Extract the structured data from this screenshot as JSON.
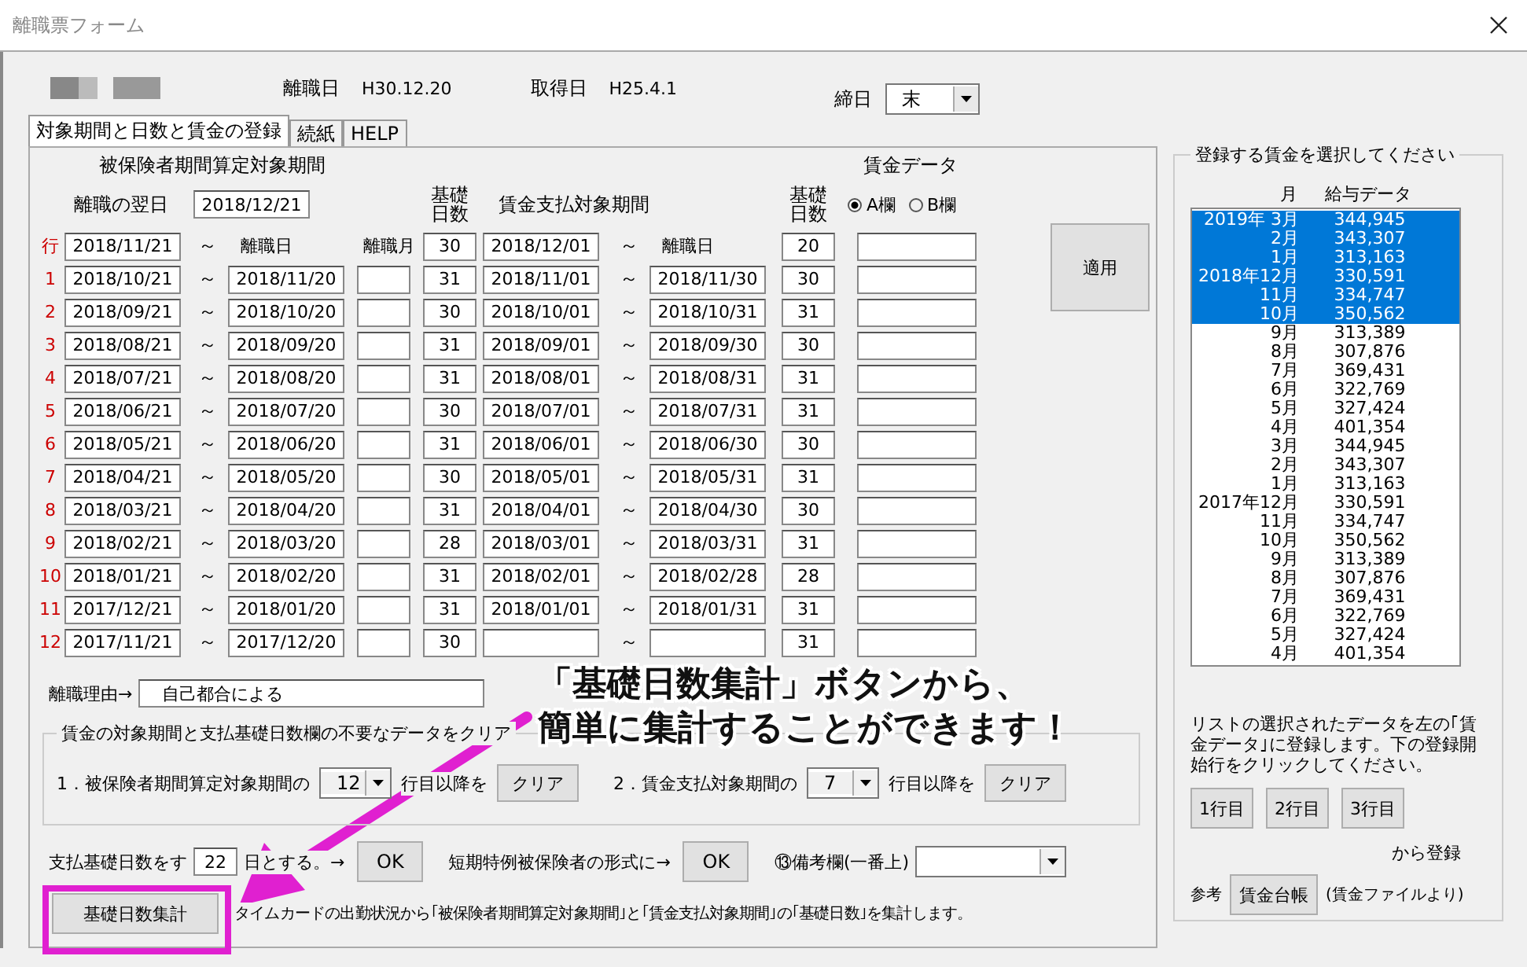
{
  "window": {
    "title": "離職票フォーム"
  },
  "header": {
    "fields": [
      {
        "label": "離職日",
        "value": "H30.12.20"
      },
      {
        "label": "取得日",
        "value": "H25.4.1"
      }
    ],
    "closing_day": {
      "label": "締日",
      "value": "末"
    }
  },
  "tabs": [
    {
      "label": "対象期間と日数と賃金の登録",
      "selected": true
    },
    {
      "label": "続紙",
      "selected": false
    },
    {
      "label": "HELP",
      "selected": false
    }
  ],
  "period": {
    "insured_heading": "被保険者期間算定対象期間",
    "next_day_label": "離職の翌日",
    "next_day": "2018/12/21",
    "days_heading": "基礎日数",
    "wage_heading": "賃金支払対象期間",
    "wage_days_heading": "基礎日数",
    "wage_data_heading": "賃金データ",
    "wage_columns": [
      {
        "label": "A欄",
        "selected": true
      },
      {
        "label": "B欄",
        "selected": false
      }
    ],
    "tilde": "～",
    "apply_button": "適用"
  },
  "rows": [
    {
      "label": "行",
      "start": "2018/11/21",
      "end_label": "離職日",
      "month_label": "離職月",
      "days": "30",
      "wage_start": "2018/12/01",
      "wage_end_label": "離職日",
      "wage_days": "20"
    },
    {
      "label": "1",
      "start": "2018/10/21",
      "end": "2018/11/20",
      "days": "31",
      "wage_start": "2018/11/01",
      "wage_end": "2018/11/30",
      "wage_days": "30"
    },
    {
      "label": "2",
      "start": "2018/09/21",
      "end": "2018/10/20",
      "days": "30",
      "wage_start": "2018/10/01",
      "wage_end": "2018/10/31",
      "wage_days": "31"
    },
    {
      "label": "3",
      "start": "2018/08/21",
      "end": "2018/09/20",
      "days": "31",
      "wage_start": "2018/09/01",
      "wage_end": "2018/09/30",
      "wage_days": "30"
    },
    {
      "label": "4",
      "start": "2018/07/21",
      "end": "2018/08/20",
      "days": "31",
      "wage_start": "2018/08/01",
      "wage_end": "2018/08/31",
      "wage_days": "31"
    },
    {
      "label": "5",
      "start": "2018/06/21",
      "end": "2018/07/20",
      "days": "30",
      "wage_start": "2018/07/01",
      "wage_end": "2018/07/31",
      "wage_days": "31"
    },
    {
      "label": "6",
      "start": "2018/05/21",
      "end": "2018/06/20",
      "days": "31",
      "wage_start": "2018/06/01",
      "wage_end": "2018/06/30",
      "wage_days": "30"
    },
    {
      "label": "7",
      "start": "2018/04/21",
      "end": "2018/05/20",
      "days": "30",
      "wage_start": "2018/05/01",
      "wage_end": "2018/05/31",
      "wage_days": "31"
    },
    {
      "label": "8",
      "start": "2018/03/21",
      "end": "2018/04/20",
      "days": "31",
      "wage_start": "2018/04/01",
      "wage_end": "2018/04/30",
      "wage_days": "30"
    },
    {
      "label": "9",
      "start": "2018/02/21",
      "end": "2018/03/20",
      "days": "28",
      "wage_start": "2018/03/01",
      "wage_end": "2018/03/31",
      "wage_days": "31"
    },
    {
      "label": "10",
      "start": "2018/01/21",
      "end": "2018/02/20",
      "days": "31",
      "wage_start": "2018/02/01",
      "wage_end": "2018/02/28",
      "wage_days": "28"
    },
    {
      "label": "11",
      "start": "2017/12/21",
      "end": "2018/01/20",
      "days": "31",
      "wage_start": "2018/01/01",
      "wage_end": "2018/01/31",
      "wage_days": "31"
    },
    {
      "label": "12",
      "start": "2017/11/21",
      "end": "2017/12/20",
      "days": "30",
      "wage_days": "31"
    }
  ],
  "reason": {
    "label": "離職理由→",
    "value": "自己都合による"
  },
  "clear_group": {
    "legend": "賃金の対象期間と支払基礎日数欄の不要なデータをクリア",
    "items": [
      {
        "label": "1．被保険者期間算定対象期間の",
        "value": "12",
        "suffix": "行目以降を",
        "button": "クリア"
      },
      {
        "label": "2．賃金支払対象期間の",
        "value": "7",
        "suffix": "行目以降を",
        "button": "クリア"
      }
    ]
  },
  "basic_days": {
    "label": "支払基礎日数をす",
    "value": "22",
    "suffix": "日とする。→",
    "button": "OK",
    "short_term_label": "短期特例被保険者の形式に→",
    "short_term_button": "OK",
    "remarks_label": "⑬備考欄(一番上)"
  },
  "tally": {
    "button": "基礎日数集計",
    "description": "タイムカードの出勤状況から｢被保険者期間算定対象期間｣と｢賃金支払対象期間｣の｢基礎日数｣を集計します。"
  },
  "wage_select": {
    "legend": "登録する賃金を選択してください",
    "month_heading": "月",
    "amount_heading": "給与データ",
    "items": [
      {
        "month": "2019年 3月",
        "amount": "344,945",
        "selected": true
      },
      {
        "month": "2月",
        "amount": "343,307",
        "selected": true
      },
      {
        "month": "1月",
        "amount": "313,163",
        "selected": true
      },
      {
        "month": "2018年12月",
        "amount": "330,591",
        "selected": true
      },
      {
        "month": "11月",
        "amount": "334,747",
        "selected": true
      },
      {
        "month": "10月",
        "amount": "350,562",
        "selected": true
      },
      {
        "month": "9月",
        "amount": "313,389",
        "selected": false
      },
      {
        "month": "8月",
        "amount": "307,876",
        "selected": false
      },
      {
        "month": "7月",
        "amount": "369,431",
        "selected": false
      },
      {
        "month": "6月",
        "amount": "322,769",
        "selected": false
      },
      {
        "month": "5月",
        "amount": "327,424",
        "selected": false
      },
      {
        "month": "4月",
        "amount": "401,354",
        "selected": false
      },
      {
        "month": "3月",
        "amount": "344,945",
        "selected": false
      },
      {
        "month": "2月",
        "amount": "343,307",
        "selected": false
      },
      {
        "month": "1月",
        "amount": "313,163",
        "selected": false
      },
      {
        "month": "2017年12月",
        "amount": "330,591",
        "selected": false
      },
      {
        "month": "11月",
        "amount": "334,747",
        "selected": false
      },
      {
        "month": "10月",
        "amount": "350,562",
        "selected": false
      },
      {
        "month": "9月",
        "amount": "313,389",
        "selected": false
      },
      {
        "month": "8月",
        "amount": "307,876",
        "selected": false
      },
      {
        "month": "7月",
        "amount": "369,431",
        "selected": false
      },
      {
        "month": "6月",
        "amount": "322,769",
        "selected": false
      },
      {
        "month": "5月",
        "amount": "327,424",
        "selected": false
      },
      {
        "month": "4月",
        "amount": "401,354",
        "selected": false
      }
    ],
    "instructions": "リストの選択されたデータを左の｢賃金データ｣に登録します。下の登録開始行をクリックしてください。",
    "row_buttons": [
      "1行目",
      "2行目",
      "3行目"
    ],
    "register_suffix": "から登録",
    "reference_label": "参考",
    "ledger_button": "賃金台帳",
    "ledger_note": "(賃金ファイルより)"
  },
  "callout": [
    "「基礎日数集計」ボタンから、",
    "簡単に集計することができます！"
  ]
}
